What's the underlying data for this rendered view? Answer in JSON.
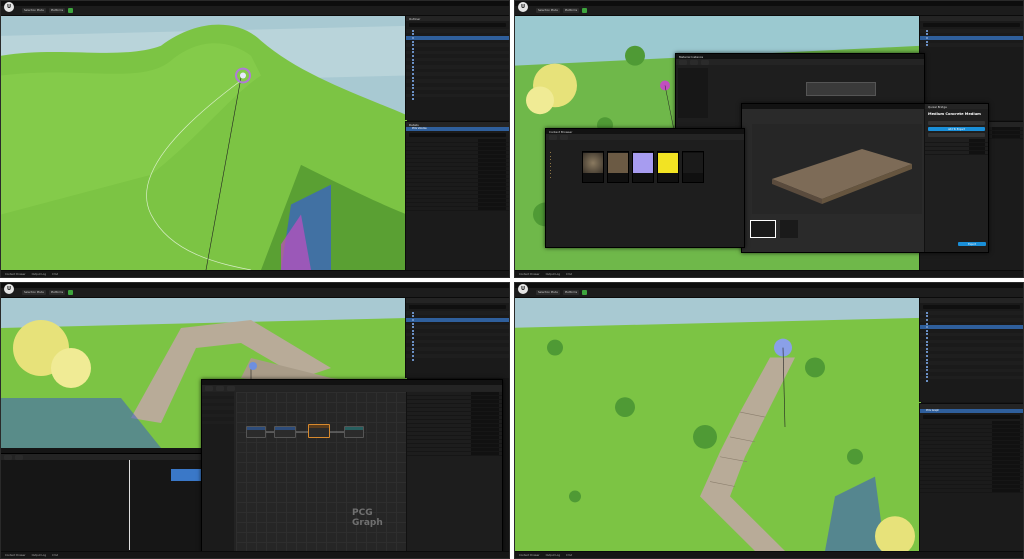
{
  "quadrants": {
    "q1": {
      "editor": "unreal-editor",
      "toolbar_buttons": [
        "Selection Mode",
        "Platforms"
      ],
      "outliner_title": "Outliner",
      "details_title": "Details",
      "details_component": "PCG Volume",
      "status_items": [
        "Content Drawer",
        "Output Log",
        "Cmd"
      ]
    },
    "q2": {
      "editor": "unreal-editor",
      "toolbar_buttons": [
        "Selection Mode",
        "Platforms"
      ],
      "material_window_title": "Material Instance",
      "content_browser_title": "Content Browser",
      "asset_name": "Medium Concrete Medium",
      "panel_heading": "Quixel Bridge",
      "add_button": "Add To Project",
      "export_button": "Export",
      "thumb_captions": [
        "",
        "",
        "",
        "",
        ""
      ],
      "status_items": [
        "Content Drawer",
        "Output Log",
        "Cmd"
      ]
    },
    "q3": {
      "editor": "unreal-editor",
      "toolbar_buttons": [
        "Selection Mode",
        "Platforms"
      ],
      "graph_watermark": "PCG Graph",
      "status_items": [
        "Content Drawer",
        "Output Log",
        "Cmd"
      ]
    },
    "q4": {
      "editor": "unreal-editor",
      "toolbar_buttons": [
        "Selection Mode",
        "Platforms"
      ],
      "details_component": "PCG Graph",
      "status_items": [
        "Content Drawer",
        "Output Log",
        "Cmd"
      ]
    }
  },
  "colors": {
    "grass": "#7cc444",
    "grass_dark": "#5aa033",
    "sky": "#9fc6d6",
    "selection": "#2f5f9c",
    "accent_blue": "#1a8fd8",
    "node_orange": "#d88a2e",
    "foliage_yellow": "#e7e27a"
  }
}
